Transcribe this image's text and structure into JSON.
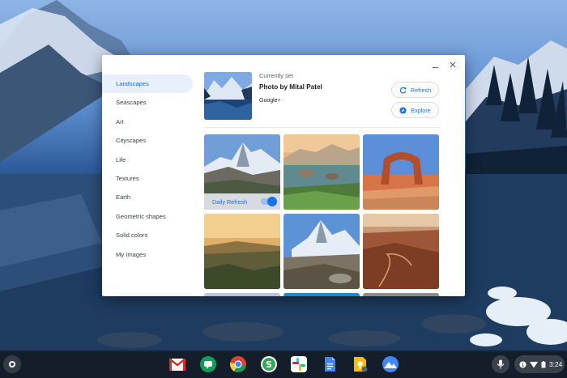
{
  "dialog": {
    "categories": [
      {
        "label": "Landscapes",
        "active": true
      },
      {
        "label": "Seascapes"
      },
      {
        "label": "Art"
      },
      {
        "label": "Cityscapes"
      },
      {
        "label": "Life"
      },
      {
        "label": "Textures"
      },
      {
        "label": "Earth"
      },
      {
        "label": "Geometric shapes"
      },
      {
        "label": "Solid colors"
      },
      {
        "label": "My Images"
      }
    ],
    "current": {
      "label": "Currently set",
      "title": "Photo by Mital Patel",
      "author": "Google+"
    },
    "refresh_label": "Refresh",
    "explore_label": "Explore",
    "daily_refresh_label": "Daily Refresh",
    "daily_refresh_on": true
  },
  "shelf": {
    "apps": [
      "gmail-icon",
      "hangouts-icon",
      "chrome-icon",
      "slides-icon",
      "slack-icon",
      "docs-icon",
      "keep-icon",
      "wallpaper-app-icon"
    ],
    "time": "3:24"
  },
  "colors": {
    "accent": "#1a73e8",
    "active_bg": "#e8f0fe"
  }
}
